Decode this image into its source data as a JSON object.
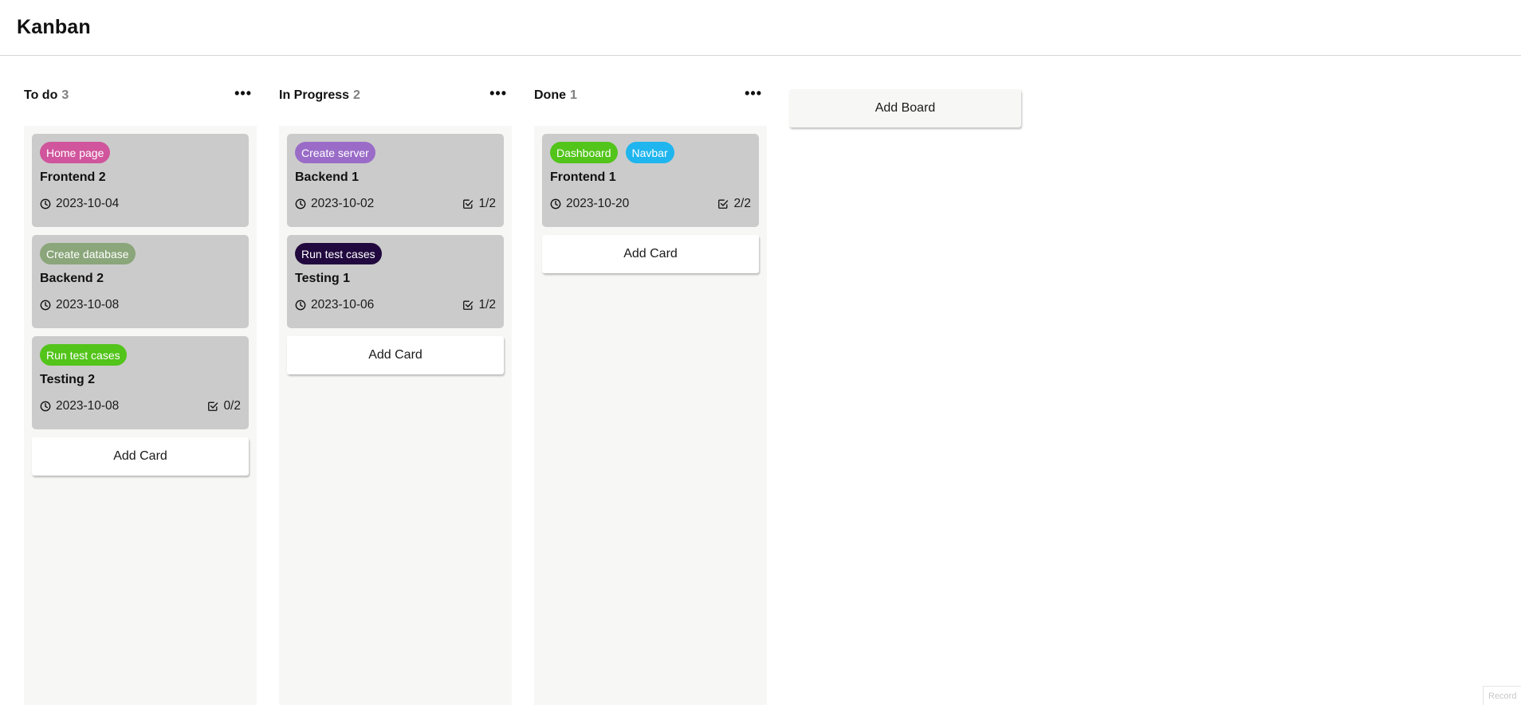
{
  "header": {
    "title": "Kanban"
  },
  "colors": {
    "home_page": "#d0559c",
    "create_database": "#8aa67a",
    "run_test_cases_green": "#52c41a",
    "create_server": "#9a6cc8",
    "run_test_cases_dark": "#21093f",
    "dashboard": "#52c41a",
    "navbar": "#1fb5ef"
  },
  "boards": [
    {
      "title": "To do",
      "count": "3",
      "menu": "•••",
      "add_card": "Add Card",
      "cards": [
        {
          "labels": [
            {
              "text": "Home page",
              "color": "#d0559c"
            }
          ],
          "title": "Frontend 2",
          "date": "2023-10-04",
          "tasks": ""
        },
        {
          "labels": [
            {
              "text": "Create database",
              "color": "#8aa67a"
            }
          ],
          "title": "Backend 2",
          "date": "2023-10-08",
          "tasks": ""
        },
        {
          "labels": [
            {
              "text": "Run test cases",
              "color": "#52c41a"
            }
          ],
          "title": "Testing 2",
          "date": "2023-10-08",
          "tasks": "0/2"
        }
      ]
    },
    {
      "title": "In Progress",
      "count": "2",
      "menu": "•••",
      "add_card": "Add Card",
      "cards": [
        {
          "labels": [
            {
              "text": "Create server",
              "color": "#9a6cc8"
            }
          ],
          "title": "Backend 1",
          "date": "2023-10-02",
          "tasks": "1/2"
        },
        {
          "labels": [
            {
              "text": "Run test cases",
              "color": "#21093f"
            }
          ],
          "title": "Testing 1",
          "date": "2023-10-06",
          "tasks": "1/2"
        }
      ]
    },
    {
      "title": "Done",
      "count": "1",
      "menu": "•••",
      "add_card": "Add Card",
      "cards": [
        {
          "labels": [
            {
              "text": "Dashboard",
              "color": "#52c41a"
            },
            {
              "text": "Navbar",
              "color": "#1fb5ef"
            }
          ],
          "title": "Frontend 1",
          "date": "2023-10-20",
          "tasks": "2/2"
        }
      ]
    }
  ],
  "add_board": "Add Board",
  "corner_badge": "Record",
  "icons": {
    "date": "clock-icon",
    "tasks": "checkbox-icon",
    "menu": "more-horizontal-icon"
  }
}
